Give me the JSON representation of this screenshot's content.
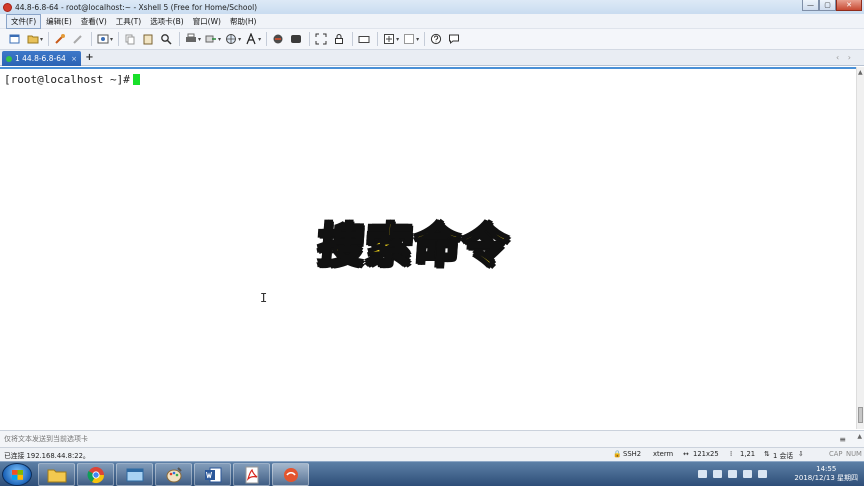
{
  "window": {
    "title": "44.8-6.8-64 - root@localhost:~ - Xshell 5 (Free for Home/School)",
    "controls": {
      "minimize": "—",
      "maximize": "▢",
      "close": "✕"
    }
  },
  "menu": [
    "文件(F)",
    "编辑(E)",
    "查看(V)",
    "工具(T)",
    "选项卡(B)",
    "窗口(W)",
    "帮助(H)"
  ],
  "tabs": {
    "active_label": "1 44.8-6.8-64",
    "close": "×",
    "add": "+",
    "nav": "‹ ›"
  },
  "terminal": {
    "prompt": "[root@localhost ~]#",
    "overlay_text": "搜索命令",
    "ibeam": "I"
  },
  "compose": {
    "placeholder": "仅将文本发送到当前选项卡",
    "menu_glyph": "≡"
  },
  "status": {
    "connection": "已连接 192.168.44.8:22。",
    "protocol": "SSH2",
    "terminal_type": "xterm",
    "size": "121x25",
    "position": "1,21",
    "sessions": "1 会话",
    "caps": "CAP",
    "num": "NUM"
  },
  "taskbar": {
    "time": "14:55",
    "date": "2018/12/13 星期四"
  },
  "colors": {
    "accent": "#2b63b4",
    "cursor": "#18e02a",
    "overlay": "#ffe11a"
  }
}
